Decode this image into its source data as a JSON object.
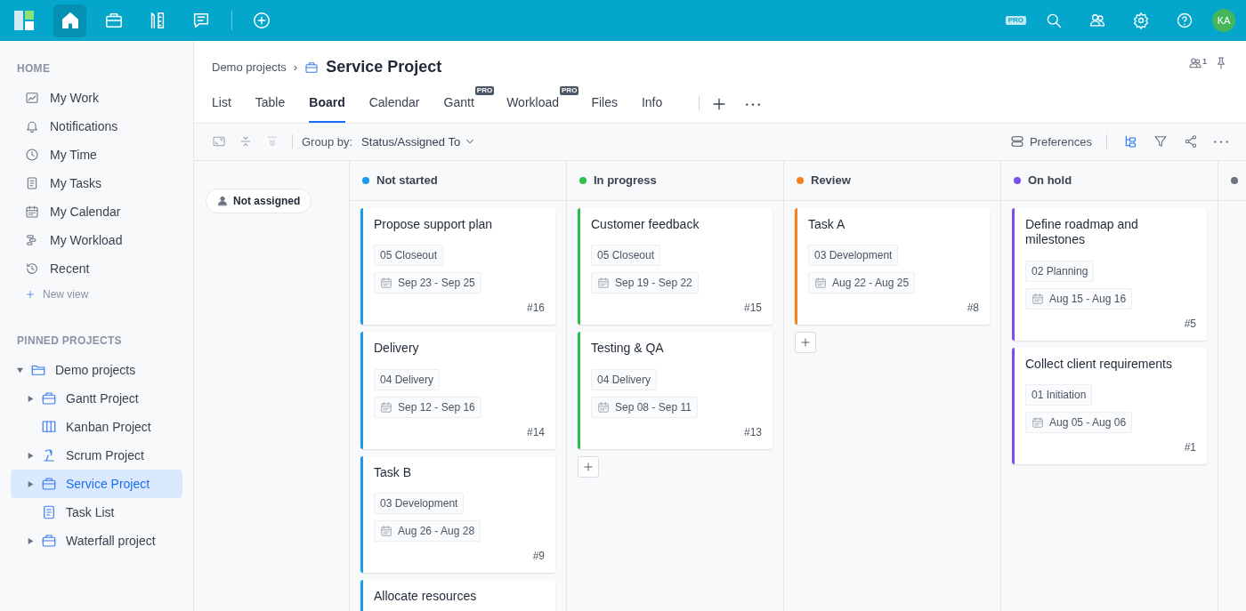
{
  "topbar": {
    "nav": [
      {
        "selected": false
      },
      {
        "selected": true
      },
      {
        "selected": false
      },
      {
        "selected": false
      },
      {
        "selected": false
      }
    ],
    "pro_badge": "PRO",
    "avatar": "KA"
  },
  "sidebar": {
    "home_title": "HOME",
    "home_items": [
      {
        "label": "My Work"
      },
      {
        "label": "Notifications"
      },
      {
        "label": "My Time"
      },
      {
        "label": "My Tasks"
      },
      {
        "label": "My Calendar"
      },
      {
        "label": "My Workload"
      },
      {
        "label": "Recent"
      }
    ],
    "new_view": "New view",
    "pinned_title": "PINNED PROJECTS",
    "tree": [
      {
        "label": "Demo projects",
        "expanded": true,
        "selected": false,
        "children": [
          {
            "label": "Gantt Project",
            "expanded": false,
            "selected": false
          },
          {
            "label": "Kanban Project",
            "selected": false
          },
          {
            "label": "Scrum Project",
            "expanded": false,
            "selected": false
          },
          {
            "label": "Service Project",
            "expanded": false,
            "selected": true
          },
          {
            "label": "Task List",
            "selected": false
          },
          {
            "label": "Waterfall project",
            "expanded": false,
            "selected": false
          }
        ]
      }
    ]
  },
  "header": {
    "breadcrumb": "Demo projects",
    "separator": "›",
    "title": "Service Project",
    "members_count": "1",
    "tabs": [
      {
        "label": "List",
        "selected": false
      },
      {
        "label": "Table",
        "selected": false
      },
      {
        "label": "Board",
        "selected": true
      },
      {
        "label": "Calendar",
        "selected": false
      },
      {
        "label": "Gantt",
        "badge": "PRO",
        "selected": false
      },
      {
        "label": "Workload",
        "badge": "PRO",
        "selected": false
      },
      {
        "label": "Files",
        "selected": false
      },
      {
        "label": "Info",
        "selected": false
      }
    ]
  },
  "toolbar": {
    "group_by_label": "Group by:",
    "group_by_value": "Status/Assigned To",
    "preferences": "Preferences"
  },
  "board": {
    "lane": "Not assigned",
    "columns": [
      {
        "title": "Not started",
        "color": "#1a9bf0",
        "cards": [
          {
            "title": "Propose support plan",
            "tag": "05 Closeout",
            "dates": "Sep 23 - Sep 25",
            "number": "#16"
          },
          {
            "title": "Delivery",
            "tag": "04 Delivery",
            "dates": "Sep 12 - Sep 16",
            "number": "#14"
          },
          {
            "title": "Task B",
            "tag": "03 Development",
            "dates": "Aug 26 - Aug 28",
            "number": "#9"
          },
          {
            "title": "Allocate resources"
          }
        ],
        "add_button": false
      },
      {
        "title": "In progress",
        "color": "#2ebd4e",
        "cards": [
          {
            "title": "Customer feedback",
            "tag": "05 Closeout",
            "dates": "Sep 19 - Sep 22",
            "number": "#15"
          },
          {
            "title": "Testing & QA",
            "tag": "04 Delivery",
            "dates": "Sep 08 - Sep 11",
            "number": "#13"
          }
        ],
        "add_button": true
      },
      {
        "title": "Review",
        "color": "#f5821f",
        "cards": [
          {
            "title": "Task A",
            "tag": "03 Development",
            "dates": "Aug 22 - Aug 25",
            "number": "#8"
          }
        ],
        "add_button": true
      },
      {
        "title": "On hold",
        "color": "#7b4fe8",
        "cards": [
          {
            "title": "Define roadmap and milestones",
            "tag": "02 Planning",
            "dates": "Aug 15 - Aug 16",
            "number": "#5"
          },
          {
            "title": "Collect client requirements",
            "tag": "01 Initiation",
            "dates": "Aug 05 - Aug 06",
            "number": "#1"
          }
        ],
        "add_button": false
      },
      {
        "color": "#6b7280",
        "add_button": false
      }
    ]
  }
}
